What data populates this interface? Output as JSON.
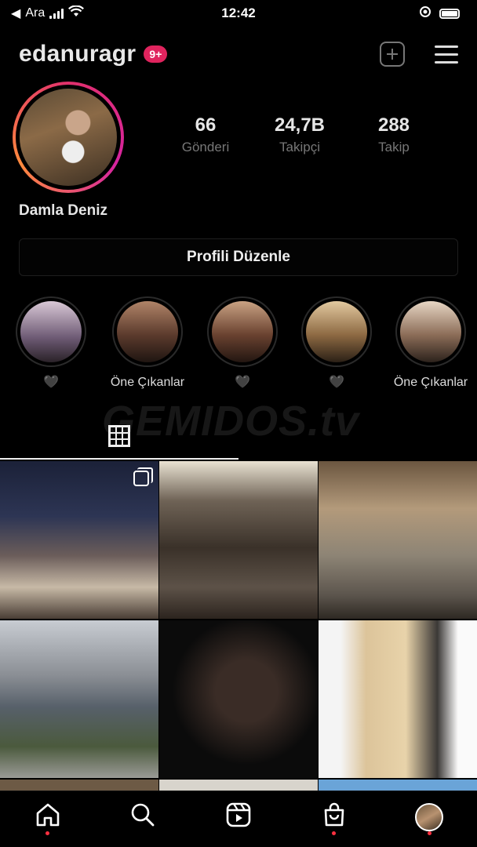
{
  "status_bar": {
    "carrier": "Ara",
    "time": "12:42"
  },
  "header": {
    "username": "edanuragr",
    "notification_badge": "9+"
  },
  "profile": {
    "display_name": "Damla Deniz",
    "stats": [
      {
        "value": "66",
        "label": "Gönderi"
      },
      {
        "value": "24,7B",
        "label": "Takipçi"
      },
      {
        "value": "288",
        "label": "Takip"
      }
    ],
    "edit_button_label": "Profili Düzenle"
  },
  "highlights": [
    {
      "label": "🖤"
    },
    {
      "label": "Öne Çıkanlar"
    },
    {
      "label": "🖤"
    },
    {
      "label": "🖤"
    },
    {
      "label": "Öne Çıkanlar"
    }
  ],
  "watermark": "GEMIDOS.tv",
  "tabs": {
    "active": "grid-icon"
  },
  "bottom_nav": [
    {
      "icon": "home-icon"
    },
    {
      "icon": "search-icon"
    },
    {
      "icon": "reels-icon"
    },
    {
      "icon": "shop-icon"
    },
    {
      "icon": "profile-avatar"
    }
  ]
}
